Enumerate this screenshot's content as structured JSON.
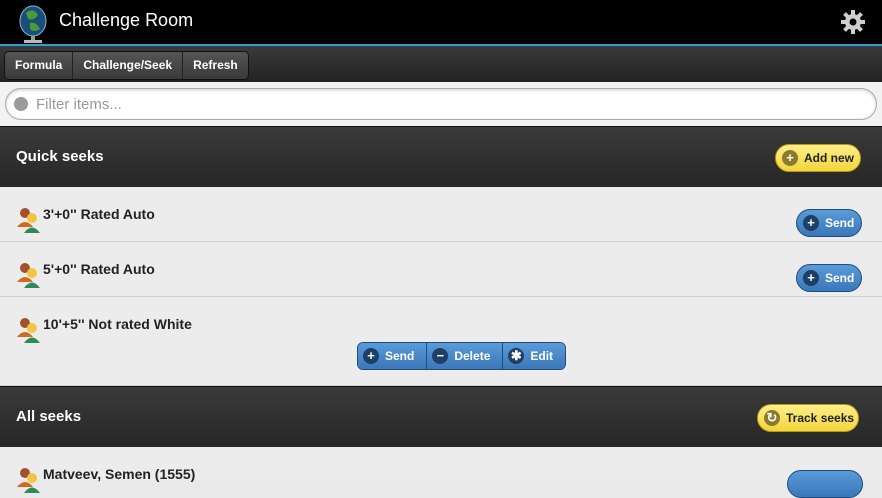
{
  "app": {
    "title": "Challenge Room",
    "logo_icon": "microphone-globe-icon",
    "settings_icon": "gear-icon"
  },
  "nav": {
    "tabs": [
      {
        "label": "Formula"
      },
      {
        "label": "Challenge/Seek"
      },
      {
        "label": "Refresh"
      }
    ]
  },
  "filter": {
    "placeholder": "Filter items...",
    "value": ""
  },
  "quick_seeks": {
    "title": "Quick seeks",
    "add_new_label": "Add new",
    "items": [
      {
        "label": "3'+0'' Rated Auto",
        "send_label": "Send"
      },
      {
        "label": "5'+0'' Rated Auto",
        "send_label": "Send"
      },
      {
        "label": "10'+5'' Not rated White",
        "send_label": "Send",
        "delete_label": "Delete",
        "edit_label": "Edit"
      }
    ]
  },
  "all_seeks": {
    "title": "All seeks",
    "track_label": "Track seeks",
    "items": [
      {
        "label": "Matveev, Semen (1555)"
      }
    ]
  },
  "colors": {
    "accent": "#2e9fd6",
    "header_bg": "#000000",
    "button_blue": "#3a77b8",
    "button_yellow": "#f3d43c"
  }
}
